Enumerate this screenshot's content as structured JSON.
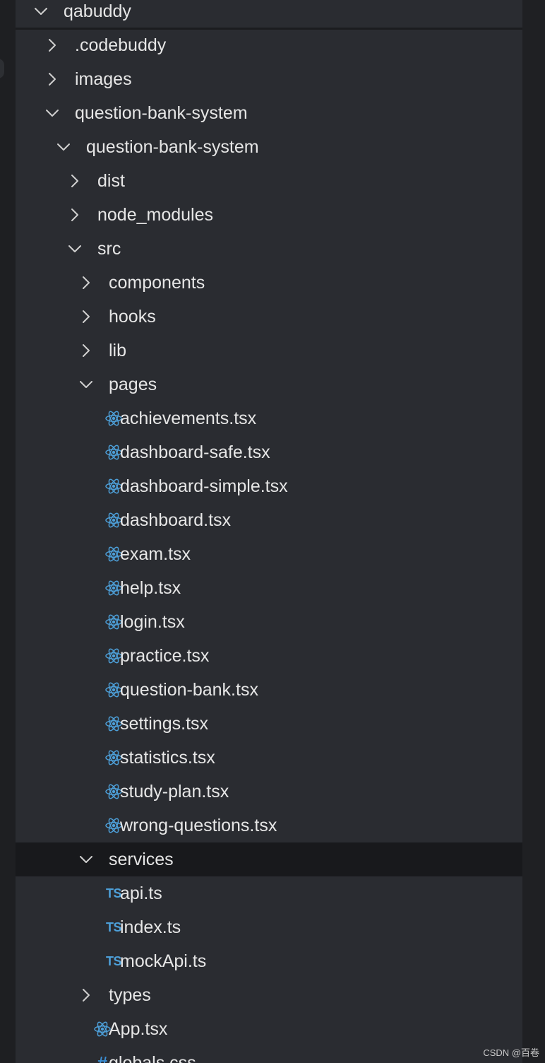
{
  "tree": [
    {
      "label": "qabuddy",
      "kind": "folder",
      "expanded": true,
      "depth": 0
    },
    {
      "label": ".codebuddy",
      "kind": "folder",
      "expanded": false,
      "depth": 1
    },
    {
      "label": "images",
      "kind": "folder",
      "expanded": false,
      "depth": 1
    },
    {
      "label": "question-bank-system",
      "kind": "folder",
      "expanded": true,
      "depth": 1
    },
    {
      "label": "question-bank-system",
      "kind": "folder",
      "expanded": true,
      "depth": 2
    },
    {
      "label": "dist",
      "kind": "folder",
      "expanded": false,
      "depth": 3
    },
    {
      "label": "node_modules",
      "kind": "folder",
      "expanded": false,
      "depth": 3
    },
    {
      "label": "src",
      "kind": "folder",
      "expanded": true,
      "depth": 3
    },
    {
      "label": "components",
      "kind": "folder",
      "expanded": false,
      "depth": 4
    },
    {
      "label": "hooks",
      "kind": "folder",
      "expanded": false,
      "depth": 4
    },
    {
      "label": "lib",
      "kind": "folder",
      "expanded": false,
      "depth": 4
    },
    {
      "label": "pages",
      "kind": "folder",
      "expanded": true,
      "depth": 4
    },
    {
      "label": "achievements.tsx",
      "kind": "tsx",
      "depth": 5
    },
    {
      "label": "dashboard-safe.tsx",
      "kind": "tsx",
      "depth": 5
    },
    {
      "label": "dashboard-simple.tsx",
      "kind": "tsx",
      "depth": 5
    },
    {
      "label": "dashboard.tsx",
      "kind": "tsx",
      "depth": 5
    },
    {
      "label": "exam.tsx",
      "kind": "tsx",
      "depth": 5
    },
    {
      "label": "help.tsx",
      "kind": "tsx",
      "depth": 5
    },
    {
      "label": "login.tsx",
      "kind": "tsx",
      "depth": 5
    },
    {
      "label": "practice.tsx",
      "kind": "tsx",
      "depth": 5
    },
    {
      "label": "question-bank.tsx",
      "kind": "tsx",
      "depth": 5
    },
    {
      "label": "settings.tsx",
      "kind": "tsx",
      "depth": 5
    },
    {
      "label": "statistics.tsx",
      "kind": "tsx",
      "depth": 5
    },
    {
      "label": "study-plan.tsx",
      "kind": "tsx",
      "depth": 5
    },
    {
      "label": "wrong-questions.tsx",
      "kind": "tsx",
      "depth": 5
    },
    {
      "label": "services",
      "kind": "folder",
      "expanded": true,
      "depth": 4,
      "selected": true
    },
    {
      "label": "api.ts",
      "kind": "ts",
      "depth": 5,
      "icon_text": "TS"
    },
    {
      "label": "index.ts",
      "kind": "ts",
      "depth": 5,
      "icon_text": "TS"
    },
    {
      "label": "mockApi.ts",
      "kind": "ts",
      "depth": 5,
      "icon_text": "TS"
    },
    {
      "label": "types",
      "kind": "folder",
      "expanded": false,
      "depth": 4
    },
    {
      "label": "App.tsx",
      "kind": "tsx",
      "depth": 4
    },
    {
      "label": "globals.css",
      "kind": "css",
      "depth": 4,
      "icon_text": "#"
    }
  ],
  "icons": {
    "tsx": "react-icon",
    "ts": "typescript-icon",
    "css": "css-hash-icon",
    "folder_collapsed": "chevron-right-icon",
    "folder_expanded": "chevron-down-icon"
  },
  "colors": {
    "panel_bg": "#2a2c31",
    "selected_row_bg": "#18191c",
    "text": "#e6e6e6",
    "react_icon": "#4d9fd8",
    "ts_icon": "#4d9fd8",
    "css_icon": "#3b8fd6"
  },
  "watermark": "CSDN @百卷"
}
